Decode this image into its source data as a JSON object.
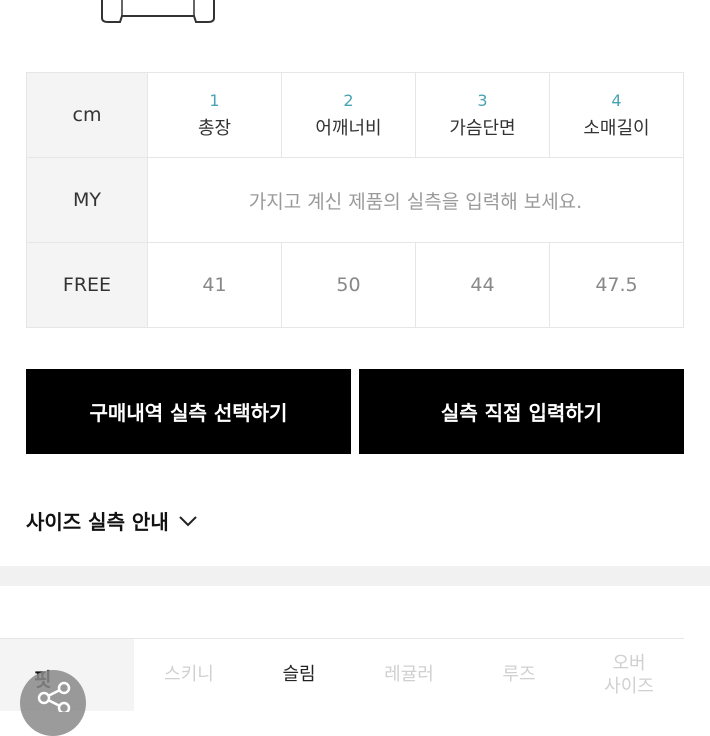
{
  "size_table": {
    "unit_label": "cm",
    "columns": [
      {
        "num": "1",
        "name": "총장"
      },
      {
        "num": "2",
        "name": "어깨너비"
      },
      {
        "num": "3",
        "name": "가슴단면"
      },
      {
        "num": "4",
        "name": "소매길이"
      }
    ],
    "my_row": {
      "label": "MY",
      "message": "가지고 계신 제품의 실측을 입력해 보세요."
    },
    "free_row": {
      "label": "FREE",
      "values": [
        "41",
        "50",
        "44",
        "47.5"
      ]
    }
  },
  "buttons": {
    "select_history": "구매내역 실측 선택하기",
    "direct_input": "실측 직접 입력하기"
  },
  "size_guide": {
    "label": "사이즈 실측 안내"
  },
  "fit": {
    "label": "핏",
    "options": [
      "스키니",
      "슬림",
      "레귤러",
      "루즈",
      "오버\n사이즈"
    ],
    "selected": "슬림"
  },
  "colors": {
    "accent_number": "#4aa3b3",
    "button_bg": "#000000"
  }
}
